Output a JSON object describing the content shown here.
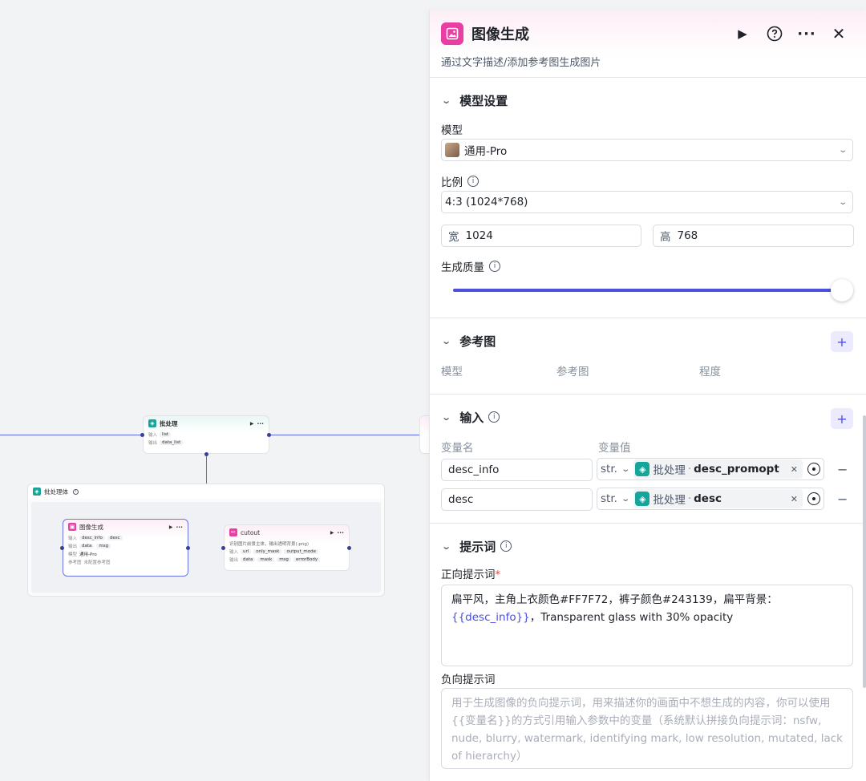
{
  "canvas": {
    "batch_node": {
      "title": "批处理",
      "input_label": "输入",
      "input_chip": "list",
      "output_label": "输出",
      "output_chip": "data_list"
    },
    "batch_body": {
      "title": "批处理体"
    },
    "image_node": {
      "title": "图像生成",
      "input_label": "输入",
      "input_chips": [
        "desc_info",
        "desc"
      ],
      "output_label": "输出",
      "output_chips": [
        "data",
        "msg"
      ],
      "model_label": "模型",
      "model_value": "通用-Pro",
      "ref_label": "参考图",
      "ref_value": "未配置参考图"
    },
    "cutout_node": {
      "title": "cutout",
      "desc": "识别图片前景主体，输出透明背景(.png)",
      "input_label": "输入",
      "input_chips": [
        "url",
        "only_mask",
        "output_mode"
      ],
      "output_label": "输出",
      "output_chips": [
        "data",
        "mask",
        "msg",
        "errorBody"
      ]
    }
  },
  "panel": {
    "title": "图像生成",
    "subtitle": "通过文字描述/添加参考图生成图片",
    "model_section": {
      "title": "模型设置",
      "model_label": "模型",
      "model_value": "通用-Pro",
      "ratio_label": "比例",
      "ratio_value": "4:3 (1024*768)",
      "width_prefix": "宽",
      "width_value": "1024",
      "height_prefix": "高",
      "height_value": "768",
      "quality_label": "生成质量",
      "quality_level": 1.0
    },
    "ref_section": {
      "title": "参考图",
      "columns": [
        "模型",
        "参考图",
        "程度"
      ]
    },
    "input_section": {
      "title": "输入",
      "col_name": "变量名",
      "col_value": "变量值",
      "rows": [
        {
          "name": "desc_info",
          "type": "str.",
          "source": "批处理",
          "var": "desc_promopt"
        },
        {
          "name": "desc",
          "type": "str.",
          "source": "批处理",
          "var": "desc"
        }
      ]
    },
    "prompt_section": {
      "title": "提示词",
      "positive_label": "正向提示词",
      "required_mark": "*",
      "positive_text_a": "扁平风，主角上衣颜色#FF7F72，裤子颜色#243139，扁平背景：",
      "positive_var": "{{desc_info}}",
      "positive_text_b": "，Transparent glass with 30% opacity",
      "negative_label": "负向提示词",
      "negative_placeholder": "用于生成图像的负向提示词，用来描述你的画面中不想生成的内容，你可以使用{{变量名}}的方式引用输入参数中的变量（系统默认拼接负向提示词：nsfw, nude, blurry, watermark, identifying mark, low resolution, mutated, lack of hierarchy）"
    },
    "colors": {
      "accent": "#4a4fe0",
      "brand_pink": "#e93fa4",
      "teal": "#16a59a"
    }
  }
}
